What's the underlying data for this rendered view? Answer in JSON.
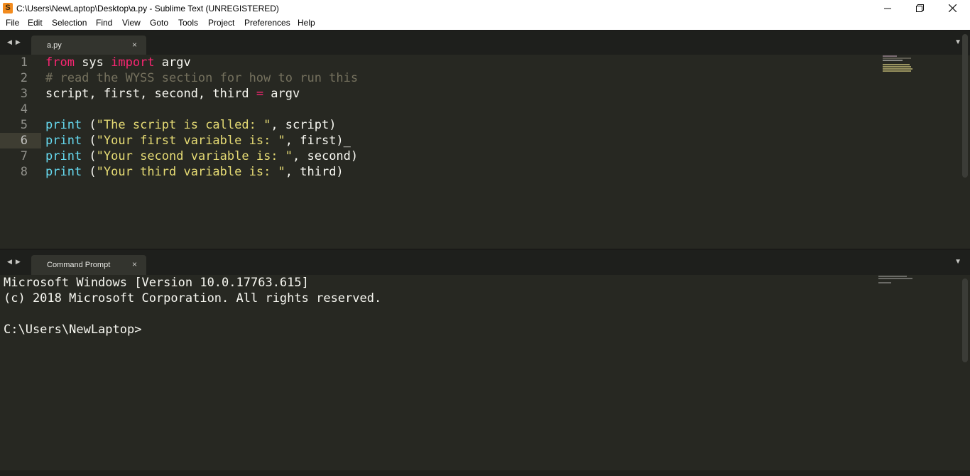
{
  "window": {
    "title": "C:\\Users\\NewLaptop\\Desktop\\a.py - Sublime Text (UNREGISTERED)",
    "icon_letter": "S",
    "minimize": "—",
    "maximize": "❐",
    "close": "✕"
  },
  "menu": {
    "items": [
      "File",
      "Edit",
      "Selection",
      "Find",
      "View",
      "Goto",
      "Tools",
      "Project",
      "Preferences",
      "Help"
    ]
  },
  "editor_pane": {
    "arrows": "◀▶",
    "tab_label": "a.py",
    "tab_close": "×",
    "dropdown": "▼",
    "line_numbers": [
      "1",
      "2",
      "3",
      "4",
      "5",
      "6",
      "7",
      "8"
    ],
    "active_line": "6",
    "lines": [
      [
        {
          "t": "from",
          "c": "kw"
        },
        {
          "t": " sys ",
          "c": ""
        },
        {
          "t": "import",
          "c": "kw"
        },
        {
          "t": " argv",
          "c": ""
        }
      ],
      [
        {
          "t": "# read the WYSS section for how to run this",
          "c": "cm"
        }
      ],
      [
        {
          "t": "script, first, second, third ",
          "c": ""
        },
        {
          "t": "=",
          "c": "kw"
        },
        {
          "t": " argv",
          "c": ""
        }
      ],
      [],
      [
        {
          "t": "print",
          "c": "fn"
        },
        {
          "t": " (",
          "c": ""
        },
        {
          "t": "\"The script is called: \"",
          "c": "str"
        },
        {
          "t": ", script)",
          "c": ""
        }
      ],
      [
        {
          "t": "print",
          "c": "fn"
        },
        {
          "t": " (",
          "c": ""
        },
        {
          "t": "\"Your first variable is: \"",
          "c": "str"
        },
        {
          "t": ", first)",
          "c": ""
        },
        {
          "t": "_",
          "c": "cursor"
        }
      ],
      [
        {
          "t": "print",
          "c": "fn"
        },
        {
          "t": " (",
          "c": ""
        },
        {
          "t": "\"Your second variable is: \"",
          "c": "str"
        },
        {
          "t": ", second)",
          "c": ""
        }
      ],
      [
        {
          "t": "print",
          "c": "fn"
        },
        {
          "t": " (",
          "c": ""
        },
        {
          "t": "\"Your third variable is: \"",
          "c": "str"
        },
        {
          "t": ", third)",
          "c": ""
        }
      ]
    ]
  },
  "console_pane": {
    "arrows": "◀▶",
    "tab_label": "Command Prompt",
    "tab_close": "×",
    "dropdown": "▼",
    "lines": [
      "Microsoft Windows [Version 10.0.17763.615]",
      "(c) 2018 Microsoft Corporation. All rights reserved.",
      "",
      "C:\\Users\\NewLaptop>"
    ]
  },
  "colors": {
    "keyword": "#f92672",
    "function": "#66d9ef",
    "string": "#e6db74",
    "comment": "#75715e",
    "background": "#272822"
  }
}
